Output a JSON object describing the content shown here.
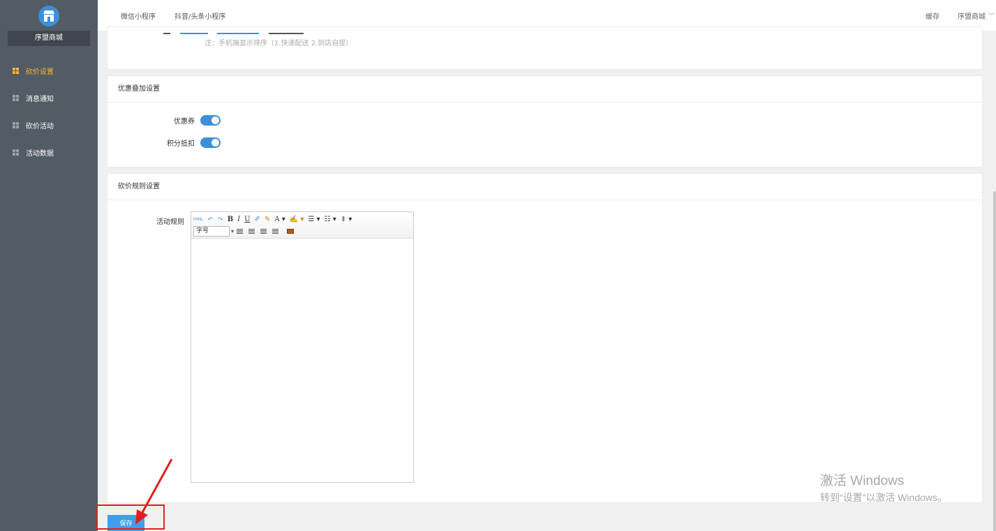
{
  "sidebar": {
    "shop_name": "序盟商城",
    "items": [
      {
        "label": "砍价设置",
        "active": true
      },
      {
        "label": "消息通知",
        "active": false
      },
      {
        "label": "砍价活动",
        "active": false
      },
      {
        "label": "活动数据",
        "active": false
      }
    ]
  },
  "topbar": {
    "tabs": [
      "微信小程序",
      "抖音/头条小程序"
    ],
    "cache": "缓存",
    "shop": "序盟商城"
  },
  "delivery": {
    "note": "注：手机端显示排序（1.快递配送 2.到店自提）"
  },
  "discount": {
    "title": "优惠叠加设置",
    "coupon_label": "优惠券",
    "coupon_on": true,
    "points_label": "积分抵扣",
    "points_on": true
  },
  "rules": {
    "title": "砍价规则设置",
    "label": "活动规则",
    "toolbar": {
      "html": "HTML",
      "bold": "B",
      "italic": "I",
      "underline": "U",
      "font_color": "A",
      "font_size": "字号"
    }
  },
  "save_label": "保存",
  "watermark": {
    "line1": "激活 Windows",
    "line2": "转到“设置”以激活 Windows。"
  },
  "colors": {
    "sidebar_bg": "#535b64",
    "accent": "#3c8fd8",
    "active_menu": "#f6b63b",
    "highlight": "#e02020"
  }
}
